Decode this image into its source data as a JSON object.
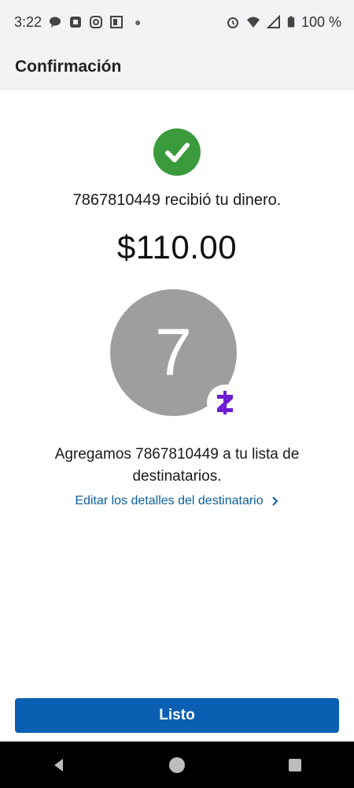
{
  "status_bar": {
    "time": "3:22",
    "battery": "100 %",
    "icons_left": [
      "chat-bubble-icon",
      "chase-logo-icon",
      "instagram-icon",
      "news-icon",
      "dot-icon"
    ],
    "icons_right": [
      "alarm-icon",
      "wifi-icon",
      "signal-icon",
      "battery-icon"
    ]
  },
  "header": {
    "title": "Confirmación"
  },
  "confirmation": {
    "received_text": "7867810449 recibió tu dinero.",
    "amount": "$110.00",
    "avatar_letter": "7",
    "added_text": "Agregamos 7867810449 a tu lista de destinatarios.",
    "edit_link": "Editar los detalles del destinatario"
  },
  "actions": {
    "done_label": "Listo"
  },
  "colors": {
    "success": "#3b9b3c",
    "link": "#0b5f9e",
    "primary_button": "#0b5fb3",
    "zelle": "#6d1ed4",
    "avatar": "#9e9e9e"
  },
  "nav": [
    "back",
    "home",
    "recents"
  ]
}
